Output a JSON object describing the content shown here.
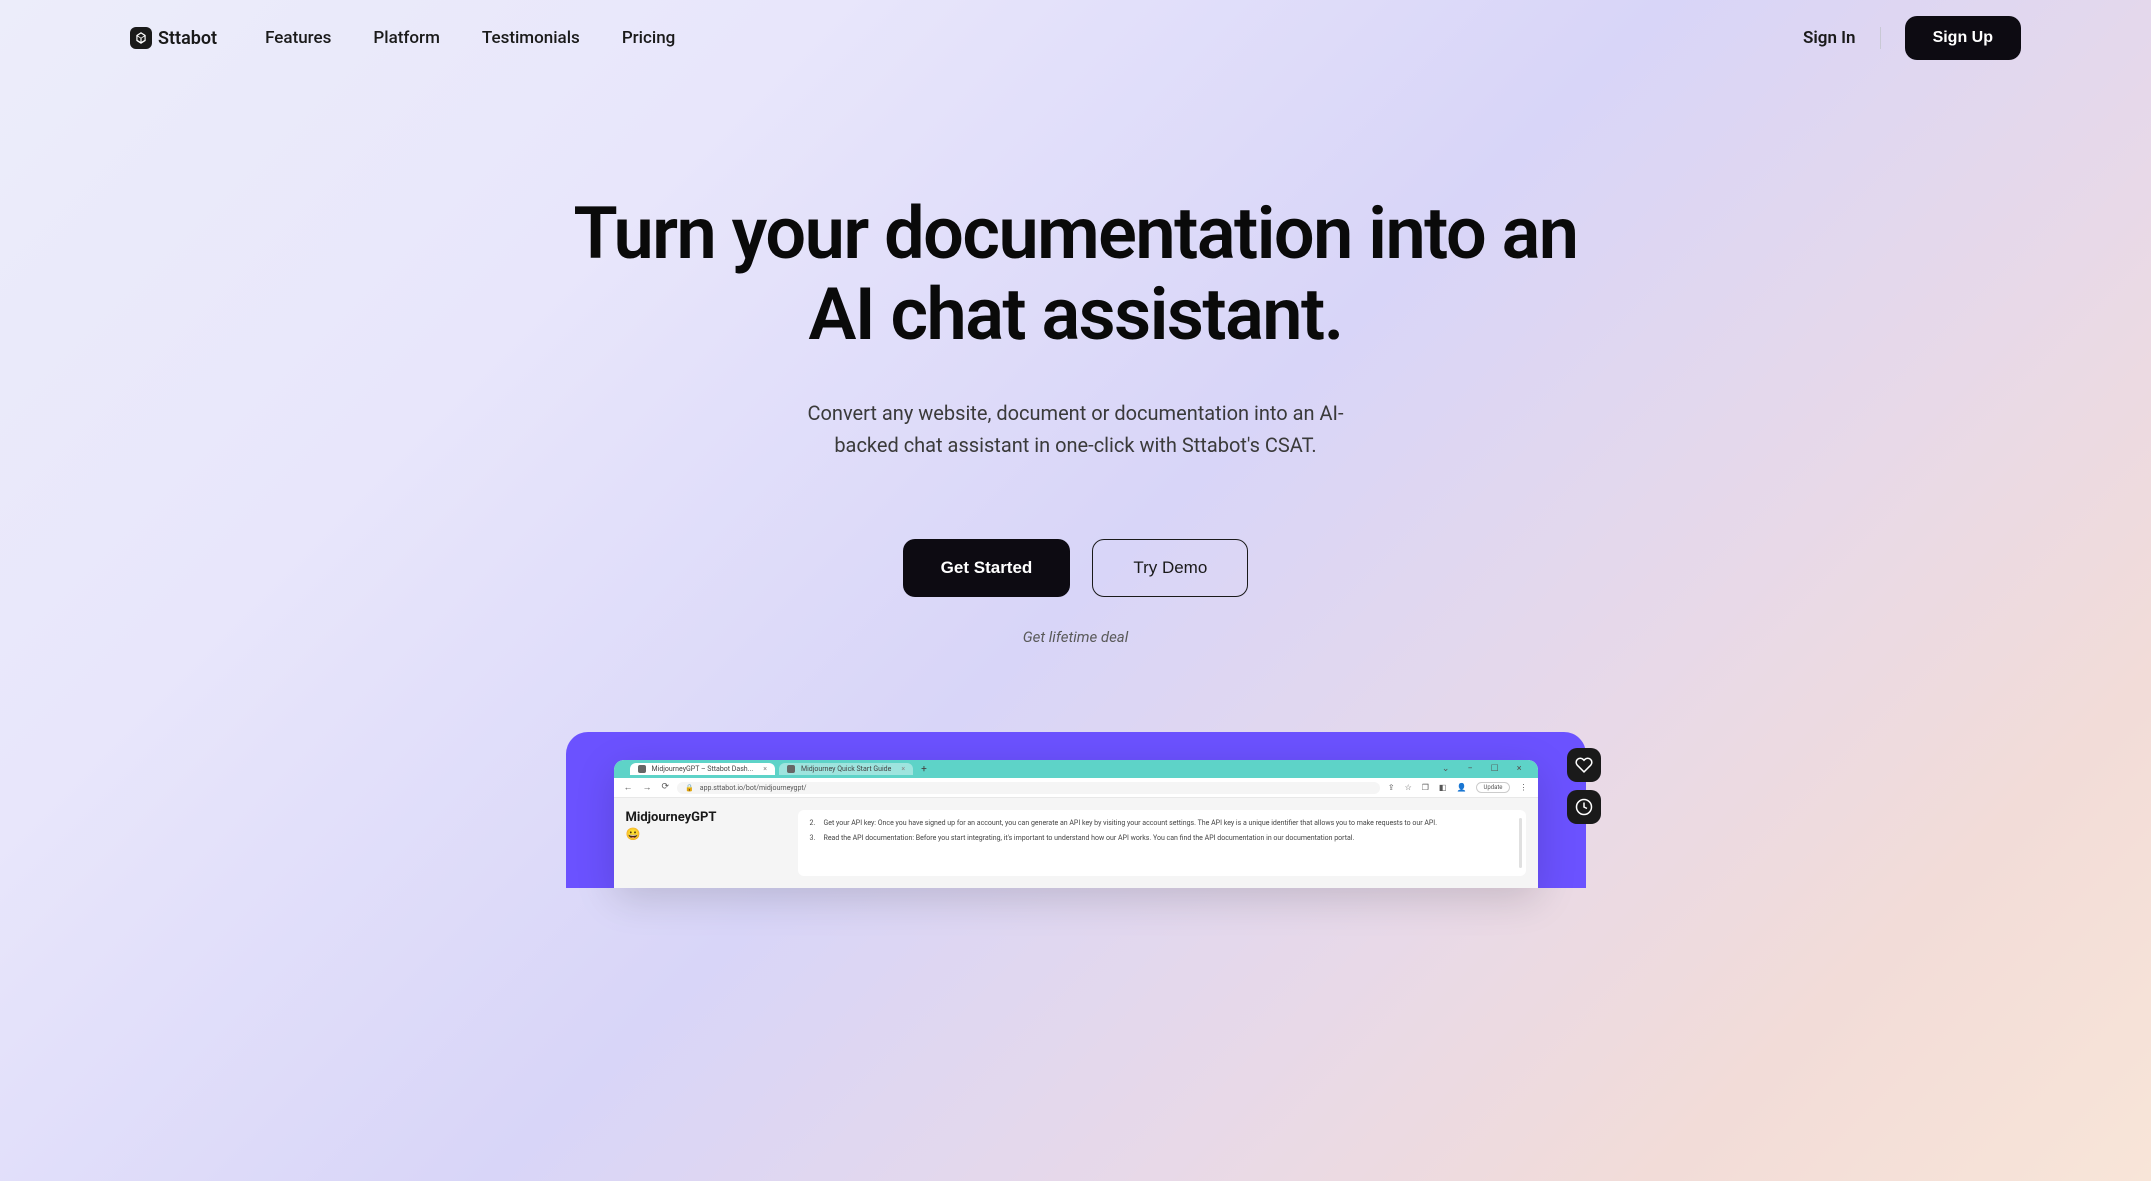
{
  "brand": {
    "name": "Sttabot"
  },
  "nav": {
    "features": "Features",
    "platform": "Platform",
    "testimonials": "Testimonials",
    "pricing": "Pricing"
  },
  "auth": {
    "signin": "Sign In",
    "signup": "Sign Up"
  },
  "hero": {
    "title": "Turn your documentation into an AI chat assistant.",
    "subtitle": "Convert any website, document or documentation into an AI-backed chat assistant in one-click with Sttabot's CSAT.",
    "cta_primary": "Get Started",
    "cta_secondary": "Try Demo",
    "lifetime": "Get lifetime deal"
  },
  "preview": {
    "tabs": {
      "tab1": "MidjourneyGPT – Sttabot Dash...",
      "tab2": "Midjourney Quick Start Guide"
    },
    "url": "app.sttabot.io/bot/midjourneygpt/",
    "update_label": "Update",
    "app_name": "MidjourneyGPT",
    "app_emoji": "😀",
    "doc_items": {
      "item2": "Get your API key: Once you have signed up for an account, you can generate an API key by visiting your account settings. The API key is a unique identifier that allows you to make requests to our API.",
      "item3": "Read the API documentation: Before you start integrating, it's important to understand how our API works. You can find the API documentation in our documentation portal."
    }
  }
}
